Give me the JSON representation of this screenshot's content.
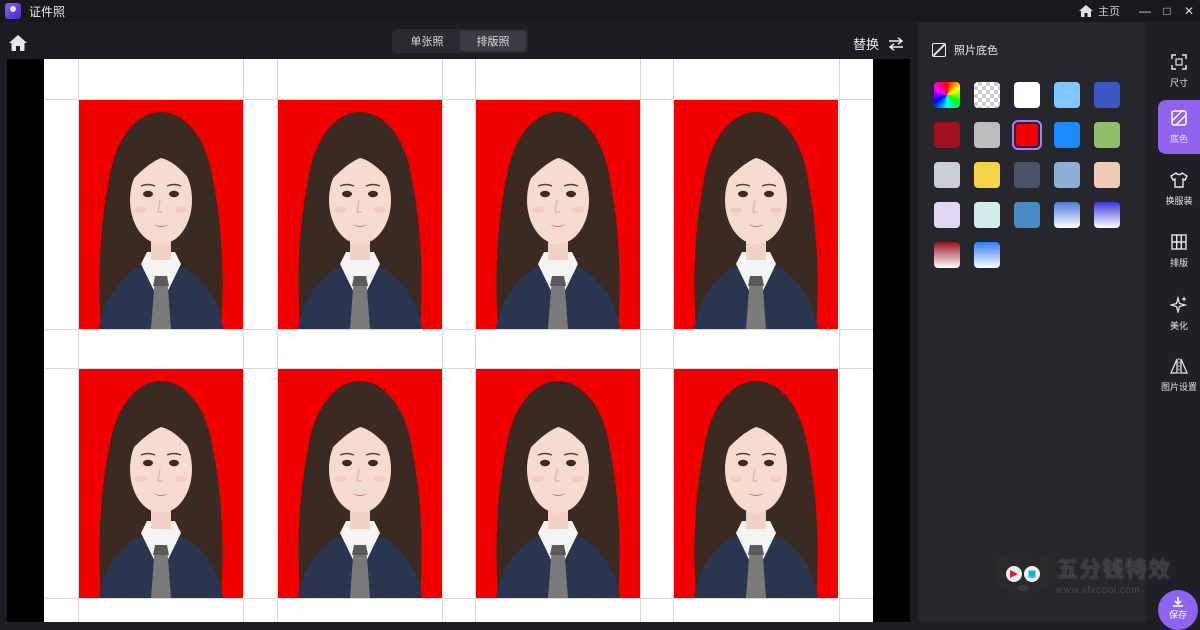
{
  "app": {
    "title": "证件照"
  },
  "titlebar": {
    "home_label": "主页",
    "minimize": "—",
    "maximize": "□",
    "close": "✕"
  },
  "mode_tabs": [
    {
      "label": "单张照",
      "active": false
    },
    {
      "label": "排版照",
      "active": true
    }
  ],
  "swap": {
    "label": "替换"
  },
  "panel": {
    "title": "照片底色",
    "swatches": [
      {
        "name": "rainbow",
        "fill": "conic-gradient(#ff0000, #ffff00, #00ff00, #00ffff, #0000ff, #ff00ff, #ff0000)"
      },
      {
        "name": "transparent",
        "fill": "repeating-conic-gradient(#cfcfcf 0% 25%, #ffffff 0% 50%) 0 0 / 8px 8px"
      },
      {
        "name": "white",
        "fill": "#ffffff"
      },
      {
        "name": "light-blue",
        "fill": "#7ec8ff"
      },
      {
        "name": "royal-blue",
        "fill": "#3c56c4"
      },
      {
        "name": "dark-red",
        "fill": "#a0101e"
      },
      {
        "name": "light-gray",
        "fill": "#bdbdbd"
      },
      {
        "name": "red",
        "fill": "#f20000",
        "selected": true
      },
      {
        "name": "blue",
        "fill": "#1e8aff"
      },
      {
        "name": "green",
        "fill": "#8fbf6a"
      },
      {
        "name": "pale-gray",
        "fill": "#c9cfd6"
      },
      {
        "name": "yellow",
        "fill": "#f6d44a"
      },
      {
        "name": "slate",
        "fill": "#4a526a"
      },
      {
        "name": "gray-blue",
        "fill": "#8eaed3"
      },
      {
        "name": "peach",
        "fill": "#f1cbb5"
      },
      {
        "name": "lavender",
        "fill": "#e1d7f3"
      },
      {
        "name": "mint",
        "fill": "#d3ebea"
      },
      {
        "name": "steel-blue",
        "fill": "#4a8ac2"
      },
      {
        "name": "blue-gradient",
        "fill": "linear-gradient(#4e78d8, #ffffff)"
      },
      {
        "name": "violet-gradient",
        "fill": "linear-gradient(#3a38d8, #ffffff)"
      },
      {
        "name": "red-gradient",
        "fill": "linear-gradient(#9a1020, #ffffff)"
      },
      {
        "name": "sky-gradient",
        "fill": "linear-gradient(#2f7cf2, #ffffff)"
      }
    ]
  },
  "toolbar": [
    {
      "label": "尺寸",
      "icon": "crop-frame-icon",
      "active": false
    },
    {
      "label": "底色",
      "icon": "background-color-icon",
      "active": true
    },
    {
      "label": "换服装",
      "icon": "shirt-icon",
      "active": false
    },
    {
      "label": "排版",
      "icon": "grid-layout-icon",
      "active": false
    },
    {
      "label": "美化",
      "icon": "sparkle-icon",
      "active": false
    },
    {
      "label": "图片设置",
      "icon": "mirror-flip-icon",
      "active": false
    }
  ],
  "save": {
    "label": "保存"
  },
  "watermark": {
    "cn": "五分钱特效",
    "url": "www.vfxcool.com"
  },
  "colors": {
    "accent": "#8e63ee",
    "photo_bg": "#f20000"
  }
}
